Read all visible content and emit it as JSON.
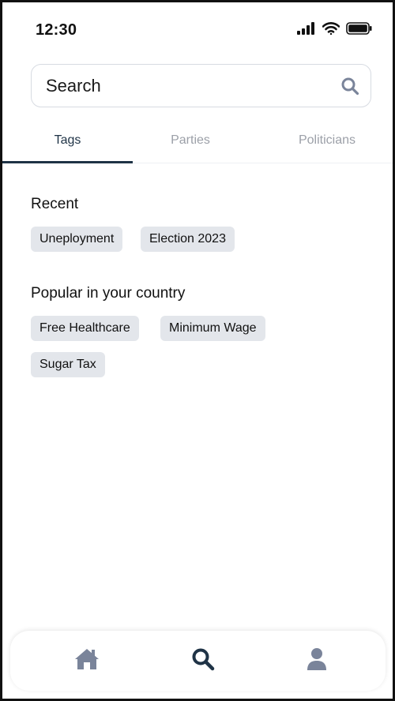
{
  "status_bar": {
    "time": "12:30"
  },
  "search": {
    "placeholder": "Search"
  },
  "tabs": [
    {
      "label": "Tags",
      "active": true
    },
    {
      "label": "Parties",
      "active": false
    },
    {
      "label": "Politicians",
      "active": false
    }
  ],
  "recent": {
    "title": "Recent",
    "chips": [
      "Uneployment",
      "Election 2023"
    ]
  },
  "popular": {
    "title": "Popular in your country",
    "chips": [
      "Free Healthcare",
      "Minimum Wage",
      "Sugar Tax"
    ]
  },
  "bottom_nav": {
    "items": [
      {
        "icon": "home-icon",
        "active": false
      },
      {
        "icon": "search-icon",
        "active": true
      },
      {
        "icon": "user-icon",
        "active": false
      }
    ]
  },
  "colors": {
    "primary": "#1f3346",
    "inactive_icon": "#7a849a",
    "chip_bg": "#e3e6eb",
    "inactive_tab": "#9ca0a8"
  }
}
